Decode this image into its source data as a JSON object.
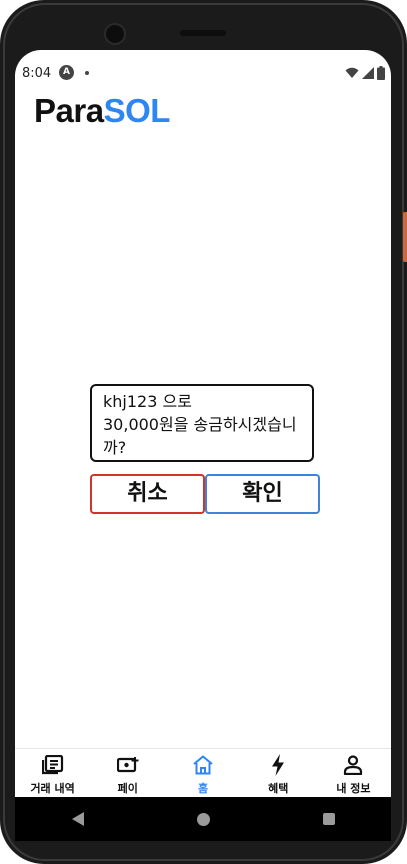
{
  "status_bar": {
    "time": "8:04",
    "notification_icon": "android-a-icon",
    "wifi_icon": "wifi-icon",
    "signal_icon": "signal-icon",
    "battery_icon": "battery-icon"
  },
  "header": {
    "logo_part1": "Para",
    "logo_part2": "SOL",
    "logo_color_1": "#111111",
    "logo_color_2": "#2e86f2"
  },
  "dialog": {
    "line1": "khj123 으로",
    "line2": "30,000원을 송금하시겠습니까?",
    "cancel_label": "취소",
    "confirm_label": "확인",
    "cancel_color": "#d0352d",
    "confirm_color": "#3f82d9"
  },
  "tabs": [
    {
      "label": "거래 내역",
      "icon": "receipt-list-icon",
      "active": false
    },
    {
      "label": "페이",
      "icon": "card-add-icon",
      "active": false
    },
    {
      "label": "홈",
      "icon": "home-icon",
      "active": true
    },
    {
      "label": "혜택",
      "icon": "lightning-icon",
      "active": false
    },
    {
      "label": "내 정보",
      "icon": "person-icon",
      "active": false
    }
  ],
  "colors": {
    "accent": "#2e86f2",
    "text": "#111111"
  }
}
